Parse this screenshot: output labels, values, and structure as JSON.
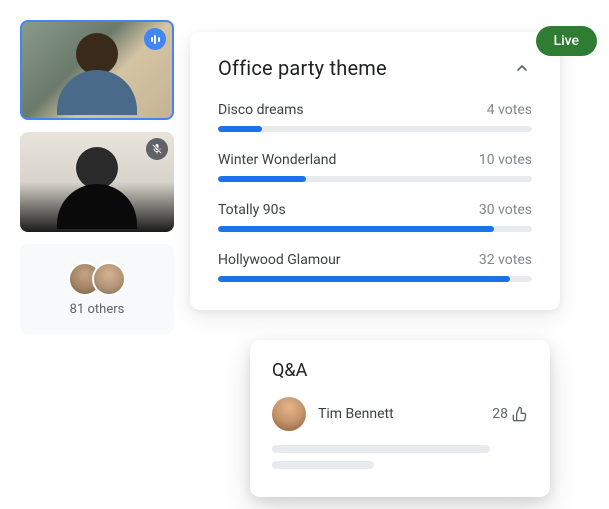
{
  "live_badge": "Live",
  "others": {
    "count_text": "81 others"
  },
  "poll": {
    "title": "Office party theme",
    "options": [
      {
        "label": "Disco dreams",
        "votes_text": "4 votes",
        "percent": 14
      },
      {
        "label": "Winter Wonderland",
        "votes_text": "10 votes",
        "percent": 28
      },
      {
        "label": "Totally 90s",
        "votes_text": "30 votes",
        "percent": 88
      },
      {
        "label": "Hollywood Glamour",
        "votes_text": "32 votes",
        "percent": 93
      }
    ]
  },
  "qa": {
    "title": "Q&A",
    "item": {
      "name": "Tim Bennett",
      "upvotes": "28"
    }
  }
}
